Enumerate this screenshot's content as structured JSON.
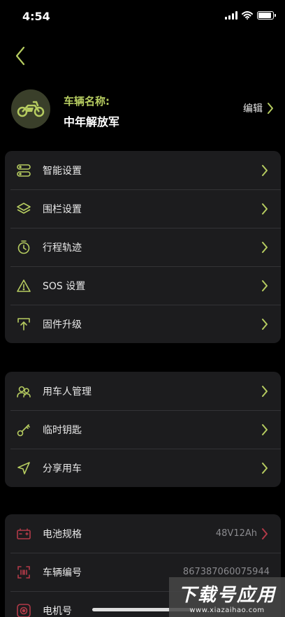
{
  "status_bar": {
    "time": "4:54"
  },
  "colors": {
    "accent": "#b6cc60",
    "red_accent": "#b33a48",
    "card_bg": "#1c1c1e"
  },
  "vehicle": {
    "label": "车辆名称:",
    "name": "中年解放军",
    "edit_label": "编辑",
    "avatar_icon": "motorbike-icon"
  },
  "settings_group_1": [
    {
      "label": "智能设置",
      "icon": "smart-settings-icon"
    },
    {
      "label": "围栏设置",
      "icon": "layers-icon"
    },
    {
      "label": "行程轨迹",
      "icon": "stopwatch-icon"
    },
    {
      "label": "SOS 设置",
      "icon": "warning-icon"
    },
    {
      "label": "固件升级",
      "icon": "upgrade-icon"
    }
  ],
  "settings_group_2": [
    {
      "label": "用车人管理",
      "icon": "users-icon"
    },
    {
      "label": "临时钥匙",
      "icon": "key-icon"
    },
    {
      "label": "分享用车",
      "icon": "share-arrow-icon"
    }
  ],
  "info_group": [
    {
      "label": "电池规格",
      "value": "48V12Ah",
      "icon": "battery-spec-icon"
    },
    {
      "label": "车辆编号",
      "value": "867387060075944",
      "icon": "barcode-scan-icon"
    },
    {
      "label": "电机号",
      "value": "",
      "icon": "motor-icon"
    }
  ],
  "watermark": {
    "main": "下载号应用",
    "sub": "www.xiazaihao.com"
  }
}
